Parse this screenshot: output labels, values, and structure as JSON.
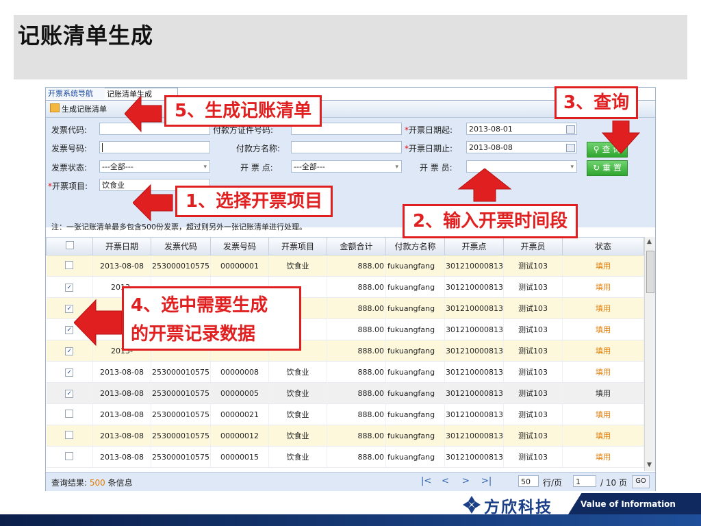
{
  "slide": {
    "title": "记账清单生成"
  },
  "tabs": [
    {
      "label": "开票系统导航"
    },
    {
      "label": "记账清单生成"
    }
  ],
  "toolbar": {
    "generate_label": "生成记账清单"
  },
  "form": {
    "invoice_code_label": "发票代码:",
    "invoice_no_label": "发票号码:",
    "invoice_status_label": "发票状态:",
    "invoice_status_value": "---全部---",
    "project_label": "开票项目:",
    "project_value": "饮食业",
    "payer_id_label": "付款方证件号码:",
    "payer_name_label": "付款方名称:",
    "point_label": "开 票 点:",
    "point_value": "---全部---",
    "date_from_label": "开票日期起:",
    "date_from_value": "2013-08-01",
    "date_to_label": "开票日期止:",
    "date_to_value": "2013-08-08",
    "clerk_label": "开 票 员:",
    "query_label": "查 询",
    "reset_label": "重 置",
    "note": "注：一张记账清单最多包含500份发票，超过则另外一张记账清单进行处理。"
  },
  "grid": {
    "headers": [
      "开票日期",
      "发票代码",
      "发票号码",
      "开票项目",
      "金额合计",
      "付款方名称",
      "开票点",
      "开票员",
      "状态"
    ],
    "rows": [
      {
        "checked": false,
        "date": "2013-08-08",
        "code": "253000010575",
        "no": "00000001",
        "item": "饮食业",
        "amount": "888.00",
        "payer": "fukuangfang",
        "point": "3012100008130(",
        "clerk": "测试103",
        "status": "填用"
      },
      {
        "checked": true,
        "date": "2013-",
        "code": "",
        "no": "",
        "item": "",
        "amount": "888.00",
        "payer": "fukuangfang",
        "point": "3012100008130(",
        "clerk": "测试103",
        "status": "填用"
      },
      {
        "checked": true,
        "date": "",
        "code": "",
        "no": "",
        "item": "",
        "amount": "888.00",
        "payer": "fukuangfang",
        "point": "3012100008130(",
        "clerk": "测试103",
        "status": "填用"
      },
      {
        "checked": true,
        "date": "",
        "code": "",
        "no": "",
        "item": "",
        "amount": "888.00",
        "payer": "fukuangfang",
        "point": "3012100008130(",
        "clerk": "测试103",
        "status": "填用"
      },
      {
        "checked": true,
        "date": "2013-",
        "code": "",
        "no": "",
        "item": "",
        "amount": "888.00",
        "payer": "fukuangfang",
        "point": "3012100008130(",
        "clerk": "测试103",
        "status": "填用"
      },
      {
        "checked": true,
        "date": "2013-08-08",
        "code": "253000010575",
        "no": "00000008",
        "item": "饮食业",
        "amount": "888.00",
        "payer": "fukuangfang",
        "point": "3012100008130(",
        "clerk": "测试103",
        "status": "填用"
      },
      {
        "checked": true,
        "date": "2013-08-08",
        "code": "253000010575",
        "no": "00000005",
        "item": "饮食业",
        "amount": "888.00",
        "payer": "fukuangfang",
        "point": "3012100008130(",
        "clerk": "测试103",
        "status": "填用"
      },
      {
        "checked": false,
        "date": "2013-08-08",
        "code": "253000010575",
        "no": "00000021",
        "item": "饮食业",
        "amount": "888.00",
        "payer": "fukuangfang",
        "point": "3012100008130(",
        "clerk": "测试103",
        "status": "填用"
      },
      {
        "checked": false,
        "date": "2013-08-08",
        "code": "253000010575",
        "no": "00000012",
        "item": "饮食业",
        "amount": "888.00",
        "payer": "fukuangfang",
        "point": "3012100008130(",
        "clerk": "测试103",
        "status": "填用"
      },
      {
        "checked": false,
        "date": "2013-08-08",
        "code": "253000010575",
        "no": "00000015",
        "item": "饮食业",
        "amount": "888.00",
        "payer": "fukuangfang",
        "point": "3012100008130(",
        "clerk": "测试103",
        "status": "填用"
      }
    ]
  },
  "footer": {
    "result_prefix": "查询结果:",
    "result_count": "500",
    "result_suffix": "条信息",
    "page_size": "50",
    "per_page_label": "行/页",
    "page_no": "1",
    "total_pages_label": "/ 10 页",
    "go_label": "GO"
  },
  "annotations": {
    "step1": "1、选择开票项目",
    "step2": "2、输入开票时间段",
    "step3": "3、查询",
    "step4_line1": "4、选中需要生成",
    "step4_line2": "的开票记录数据",
    "step5": "5、生成记账清单"
  },
  "brand": {
    "name": "方欣科技",
    "tagline": "Value of Information"
  },
  "colors": {
    "accent_red": "#e02020",
    "button_green": "#2fa52f",
    "status_orange": "#e07a00",
    "brand_blue": "#1a3f86"
  }
}
